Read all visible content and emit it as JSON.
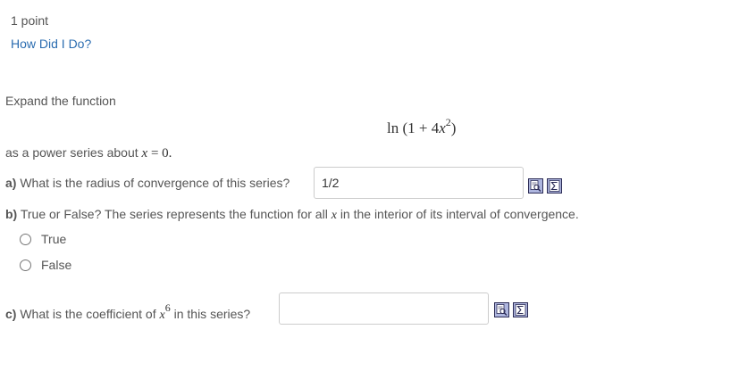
{
  "header": {
    "points": "1 point",
    "how_link": "How Did I Do?"
  },
  "problem": {
    "prompt": "Expand the function",
    "formula": {
      "fn": "ln",
      "open": "(1 + 4",
      "var": "x",
      "exp": "2",
      "close": ")"
    },
    "about": {
      "text": "as a power series about",
      "var": "x",
      "rest": " = 0."
    }
  },
  "part_a": {
    "label": "a)",
    "question": " What is the radius of convergence of this series?",
    "answer": "1/2"
  },
  "part_b": {
    "label": "b)",
    "question_before": " True or False? The series represents the function for all",
    "var": "x",
    "question_after": "in the interior of its interval of convergence.",
    "options": [
      "True",
      "False"
    ]
  },
  "part_c": {
    "label": "c)",
    "question_before": " What is the coefficient of",
    "var": "x",
    "exp": "6",
    "question_after": "in this series?",
    "answer": ""
  },
  "colors": {
    "text": "#555555",
    "link": "#2a6cb0",
    "tool_fill": "#aeb6df",
    "tool_border": "#2b2b55"
  },
  "icons": {
    "preview": "magnifier-preview-icon",
    "equation": "sigma-equation-icon"
  }
}
